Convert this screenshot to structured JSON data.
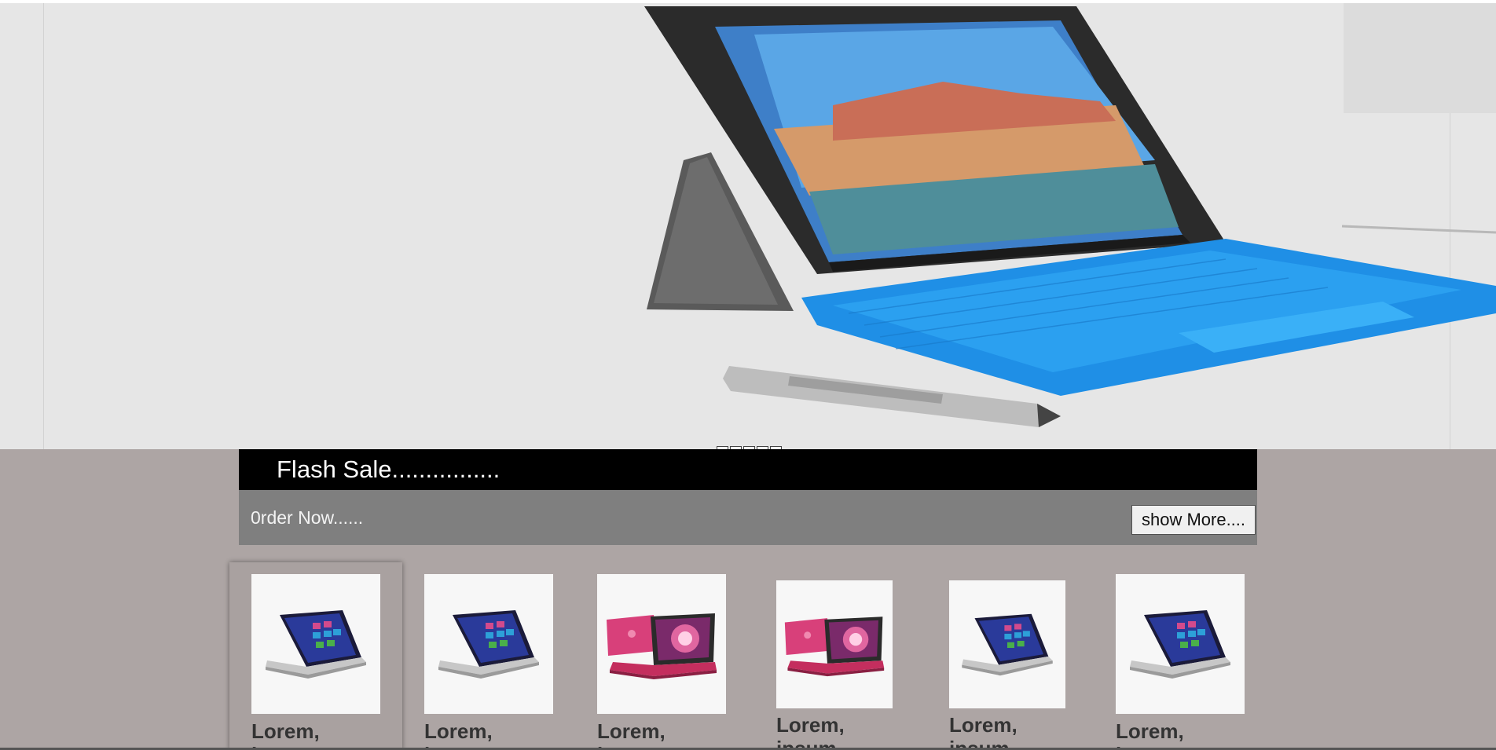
{
  "hero": {
    "image_alt": "Surface Pro tablet with blue keyboard and pen",
    "indicator_count": 5,
    "active_indicator": 1
  },
  "flash_sale": {
    "title": "Flash Sale................",
    "order_text": "0rder Now......",
    "show_more_label": "show More...."
  },
  "products": [
    {
      "name": "Lorem,\nipsum",
      "image": "laptop-dark",
      "selected": true
    },
    {
      "name": "Lorem,\nipsum",
      "image": "laptop-dark",
      "selected": false
    },
    {
      "name": "Lorem,\nipsum",
      "image": "laptop-pink",
      "selected": false
    },
    {
      "name": "Lorem,\nipsum",
      "image": "laptop-pink",
      "selected": false
    },
    {
      "name": "Lorem,\nipsum",
      "image": "laptop-dark",
      "selected": false
    },
    {
      "name": "Lorem,\nipsum",
      "image": "laptop-dark",
      "selected": false
    }
  ],
  "colors": {
    "section_bg": "#ada5a4",
    "flash_bar": "#000000",
    "order_bar": "#7f7f7f",
    "keyboard_blue": "#1f8fe6"
  }
}
